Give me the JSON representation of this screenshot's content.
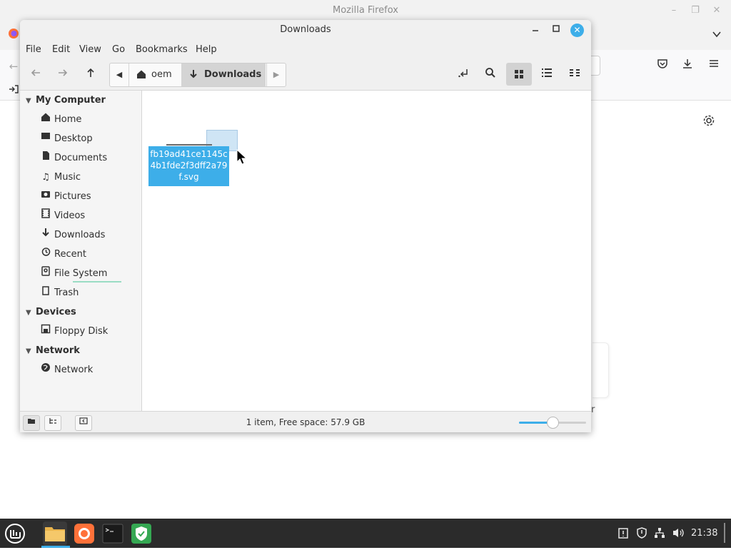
{
  "firefox": {
    "title": "Mozilla Firefox",
    "partial_text": "r",
    "icons": [
      "firefox-icon",
      "back-icon",
      "sidebar-icon",
      "pocket-icon",
      "download-icon",
      "menu-icon",
      "gear-icon",
      "chevron-down-icon"
    ]
  },
  "nemo": {
    "title": "Downloads",
    "menu": [
      "File",
      "Edit",
      "View",
      "Go",
      "Bookmarks",
      "Help"
    ],
    "pathbar": {
      "home_label": "oem",
      "current_label": "Downloads"
    },
    "sidebar": {
      "sections": [
        {
          "title": "My Computer",
          "items": [
            {
              "label": "Home",
              "icon": "home-icon"
            },
            {
              "label": "Desktop",
              "icon": "desktop-icon"
            },
            {
              "label": "Documents",
              "icon": "documents-icon"
            },
            {
              "label": "Music",
              "icon": "music-icon"
            },
            {
              "label": "Pictures",
              "icon": "pictures-icon"
            },
            {
              "label": "Videos",
              "icon": "videos-icon"
            },
            {
              "label": "Downloads",
              "icon": "downloads-icon"
            },
            {
              "label": "Recent",
              "icon": "recent-icon"
            },
            {
              "label": "File System",
              "icon": "filesystem-icon"
            },
            {
              "label": "Trash",
              "icon": "trash-icon"
            }
          ]
        },
        {
          "title": "Devices",
          "items": [
            {
              "label": "Floppy Disk",
              "icon": "floppy-icon"
            }
          ]
        },
        {
          "title": "Network",
          "items": [
            {
              "label": "Network",
              "icon": "network-icon"
            }
          ]
        }
      ]
    },
    "file": {
      "name": "fb19ad41ce1145c4b1fde2f3dff2a79f.svg",
      "selected": true
    },
    "status": "1 item, Free space: 57.9 GB",
    "zoom_level": 0.5
  },
  "taskbar": {
    "apps": [
      "files",
      "firefox",
      "terminal",
      "security"
    ],
    "clock": "21:38"
  },
  "colors": {
    "accent": "#3daee9",
    "taskbar": "#2b2b2b",
    "sidebar": "#f5f5f5",
    "toolbar": "#f0f0f0"
  }
}
